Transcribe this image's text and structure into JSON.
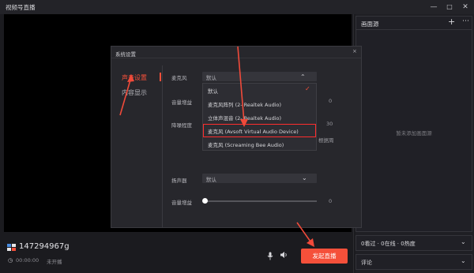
{
  "window": {
    "title": "视频号直播",
    "min": "—",
    "max": "□",
    "close": "✕"
  },
  "scene_panel": {
    "title": "画面源",
    "add": "+",
    "more": "⋯",
    "empty": "暂未添加画面源"
  },
  "stats_panel": {
    "text": "0看过 · 0在线 · 0热度",
    "chevron": "⌄"
  },
  "comment_panel": {
    "text": "评论",
    "chevron": "⌄"
  },
  "account": {
    "name": "147294967g",
    "time": "00:00:00",
    "status": "未开播"
  },
  "bottom": {
    "start_label": "发起直播",
    "mic_icon": "mic-icon",
    "speaker_icon": "speaker-icon"
  },
  "dialog": {
    "title": "系统设置",
    "close": "×",
    "nav": {
      "audio": "声音设置",
      "content": "内容显示"
    },
    "mic_label": "麦克风",
    "mic_selected": "默认",
    "mic_chevron": "⌃",
    "volume_gain_label": "音量增益",
    "volume_gain_value": "0",
    "noise_label": "降噪程度",
    "noise_value": "30",
    "noise_hint": "根据周",
    "speaker_label": "扬声器",
    "speaker_selected": "默认",
    "speaker_chevron": "⌄",
    "speaker_gain_label": "音量增益",
    "speaker_gain_value": "0",
    "speaker_gain_level": 0,
    "dropdown": [
      {
        "label": "默认",
        "selected": true
      },
      {
        "label": "麦克风阵列 (2- Realtek Audio)",
        "selected": false
      },
      {
        "label": "立体声混音 (2- Realtek Audio)",
        "selected": false
      },
      {
        "label": "麦克风 (Avsoft Virtual Audio Device)",
        "selected": false,
        "highlighted": true
      },
      {
        "label": "麦克风 (Screaming Bee Audio)",
        "selected": false
      }
    ],
    "check": "✓"
  },
  "colors": {
    "accent": "#f5503a",
    "highlight_box": "#ff2d2d",
    "arrow": "#f04a3a"
  }
}
